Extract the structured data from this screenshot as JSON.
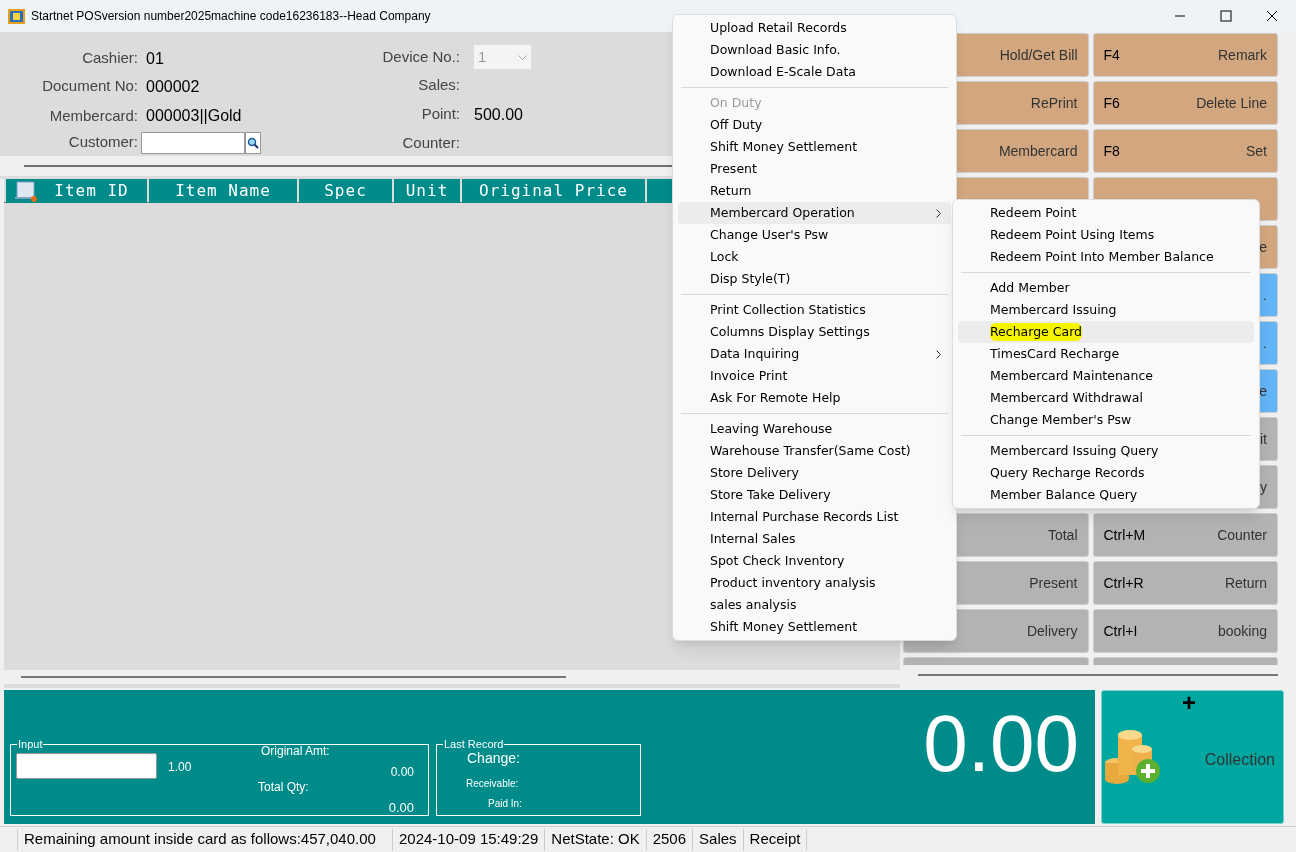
{
  "window": {
    "title": "Startnet POSversion number2025machine code16236183--Head Company"
  },
  "info_left": [
    {
      "label": "Cashier:",
      "value": "01"
    },
    {
      "label": "Document No:",
      "value": "000002"
    },
    {
      "label": "Membercard:",
      "value": "000003||Gold"
    },
    {
      "label": "Customer:",
      "kind": "lookup"
    }
  ],
  "info_right": [
    {
      "label": "Device No.:",
      "value": "1",
      "kind": "select",
      "disabled": true
    },
    {
      "label": "Sales:"
    },
    {
      "label": "Point:",
      "value": "500.00"
    },
    {
      "label": "Counter:"
    }
  ],
  "table": {
    "columns": [
      "Item ID",
      "Item Name",
      "Spec",
      "Unit",
      "Original Price"
    ]
  },
  "input_panel": {
    "legend": "Input",
    "qty": "1.00",
    "original_amt_label": "Original Amt:",
    "original_amt": "0.00",
    "total_qty_label": "Total Qty:",
    "total_qty": "0.00"
  },
  "last_record": {
    "legend": "Last Record",
    "change_label": "Change:",
    "receivable_label": "Receivable:",
    "paid_in_label": "Paid In:"
  },
  "total": "0.00",
  "collection_button": {
    "plus": "+",
    "label": "Collection"
  },
  "keypad": [
    [
      {
        "label": "Hold/Get Bill",
        "color": "#d2a77f"
      },
      {
        "key": "F4",
        "label": "Remark",
        "color": "#d2a77f"
      }
    ],
    [
      {
        "label": "RePrint",
        "color": "#d2a77f"
      },
      {
        "key": "F6",
        "label": "Delete Line",
        "color": "#d2a77f"
      }
    ],
    [
      {
        "label": "Membercard",
        "color": "#d2a77f"
      },
      {
        "key": "F8",
        "label": "Set",
        "color": "#d2a77f"
      }
    ],
    [
      {
        "color": "#d2a77f"
      },
      {
        "color": "#d2a77f"
      }
    ],
    [
      {
        "label": "e",
        "color": "#d2a77f"
      }
    ],
    [
      {
        "label": ".",
        "color": "#64b5f6"
      }
    ],
    [
      {
        "label": ".",
        "color": "#64b5f6"
      }
    ],
    [
      {
        "label": "e",
        "color": "#64b5f6"
      }
    ],
    [
      {
        "label": "it",
        "color": "#b3b3b3"
      }
    ],
    [
      {
        "label": "y",
        "color": "#b3b3b3"
      }
    ],
    [
      {
        "label": "Total",
        "color": "#b3b3b3"
      },
      {
        "key": "Ctrl+M",
        "label": "Counter",
        "color": "#b3b3b3"
      }
    ],
    [
      {
        "label": "Present",
        "color": "#b3b3b3"
      },
      {
        "key": "Ctrl+R",
        "label": "Return",
        "color": "#b3b3b3"
      }
    ],
    [
      {
        "label": "Delivery",
        "color": "#b3b3b3"
      },
      {
        "key": "Ctrl+I",
        "label": "booking",
        "color": "#b3b3b3"
      }
    ],
    [
      {
        "color": "#b3b3b3"
      },
      {
        "color": "#b3b3b3"
      }
    ]
  ],
  "menu": [
    [
      {
        "label": "Upload Retail Records",
        "disabled": false,
        "selected": false
      },
      {
        "label": "Download Basic Info.",
        "disabled": false,
        "selected": false
      },
      {
        "label": "Download E-Scale Data",
        "disabled": false,
        "selected": false
      }
    ],
    [
      {
        "label": "On Duty",
        "disabled": true,
        "selected": false
      },
      {
        "label": "Off Duty",
        "disabled": false,
        "selected": false
      },
      {
        "label": "Shift Money Settlement",
        "disabled": false,
        "selected": false
      },
      {
        "label": "Present",
        "disabled": false,
        "selected": false
      },
      {
        "label": "Return",
        "disabled": false,
        "selected": false
      },
      {
        "label": "Membercard Operation",
        "disabled": false,
        "selected": true,
        "submenu": true
      },
      {
        "label": "Change User's Psw",
        "disabled": false,
        "selected": false
      },
      {
        "label": "Lock",
        "disabled": false,
        "selected": false
      },
      {
        "label": "Disp Style(T)",
        "disabled": false,
        "selected": false
      }
    ],
    [
      {
        "label": "Print Collection Statistics",
        "disabled": false,
        "selected": false
      },
      {
        "label": "Columns Display Settings",
        "disabled": false,
        "selected": false
      },
      {
        "label": "Data Inquiring",
        "disabled": false,
        "selected": false,
        "submenu": true
      },
      {
        "label": "Invoice Print",
        "disabled": false,
        "selected": false
      },
      {
        "label": "Ask For Remote Help",
        "disabled": false,
        "selected": false
      }
    ],
    [
      {
        "label": "Leaving Warehouse",
        "disabled": false,
        "selected": false
      },
      {
        "label": "Warehouse Transfer(Same Cost)",
        "disabled": false,
        "selected": false
      },
      {
        "label": "Store Delivery",
        "disabled": false,
        "selected": false
      },
      {
        "label": "Store Take Delivery",
        "disabled": false,
        "selected": false
      },
      {
        "label": "Internal Purchase Records List",
        "disabled": false,
        "selected": false
      },
      {
        "label": "Internal Sales",
        "disabled": false,
        "selected": false
      },
      {
        "label": "Spot Check Inventory",
        "disabled": false,
        "selected": false
      },
      {
        "label": "Product inventory analysis",
        "disabled": false,
        "selected": false
      },
      {
        "label": "sales analysis",
        "disabled": false,
        "selected": false
      },
      {
        "label": "Shift Money Settlement",
        "disabled": false,
        "selected": false
      }
    ]
  ],
  "submenu": [
    [
      {
        "label": "Redeem Point",
        "selected": false,
        "highlighted": false
      },
      {
        "label": "Redeem Point Using Items",
        "selected": false,
        "highlighted": false
      },
      {
        "label": "Redeem Point Into Member Balance",
        "selected": false,
        "highlighted": false
      }
    ],
    [
      {
        "label": "Add Member",
        "selected": false,
        "highlighted": false
      },
      {
        "label": "Membercard Issuing",
        "selected": false,
        "highlighted": false
      },
      {
        "label": "Recharge Card",
        "selected": true,
        "highlighted": true
      },
      {
        "label": "TimesCard Recharge",
        "selected": false,
        "highlighted": false
      },
      {
        "label": "Membercard Maintenance",
        "selected": false,
        "highlighted": false
      },
      {
        "label": "Membercard Withdrawal",
        "selected": false,
        "highlighted": false
      },
      {
        "label": "Change Member's Psw",
        "selected": false,
        "highlighted": false
      }
    ],
    [
      {
        "label": "Membercard Issuing Query",
        "selected": false,
        "highlighted": false
      },
      {
        "label": "Query Recharge Records",
        "selected": false,
        "highlighted": false
      },
      {
        "label": "Member Balance Query",
        "selected": false,
        "highlighted": false
      }
    ]
  ],
  "status_bar": [
    "Remaining amount inside card as follows:457,040.00",
    "2024-10-09 15:49:29",
    "NetState: OK",
    "2506",
    "Sales",
    "Receipt"
  ]
}
